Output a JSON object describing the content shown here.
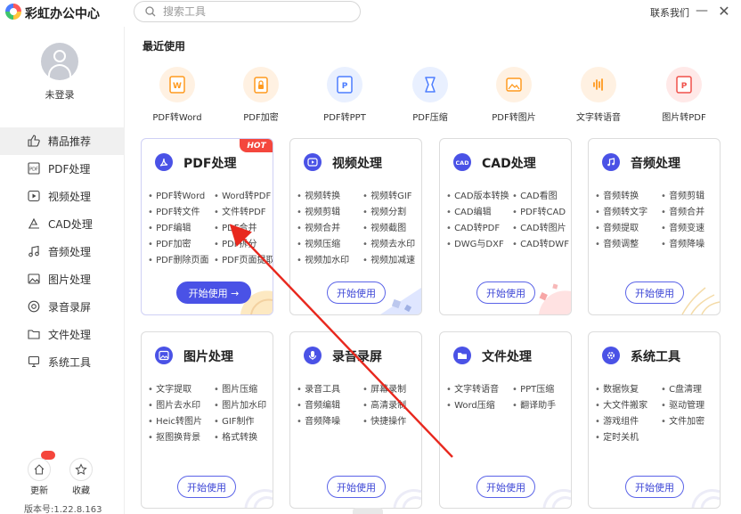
{
  "app": {
    "title": "彩虹办公中心",
    "contact_label": "联系我们",
    "minimize_glyph": "—",
    "close_glyph": "✕"
  },
  "search": {
    "placeholder": "搜索工具",
    "value": ""
  },
  "user": {
    "status": "未登录"
  },
  "sidebar": {
    "items": [
      {
        "label": "精品推荐",
        "icon": "thumbs-up-icon",
        "active": true
      },
      {
        "label": "PDF处理",
        "icon": "pdf-file-icon"
      },
      {
        "label": "视频处理",
        "icon": "video-icon"
      },
      {
        "label": "CAD处理",
        "icon": "cad-icon"
      },
      {
        "label": "音频处理",
        "icon": "music-note-icon"
      },
      {
        "label": "图片处理",
        "icon": "image-icon"
      },
      {
        "label": "录音录屏",
        "icon": "record-icon"
      },
      {
        "label": "文件处理",
        "icon": "folder-icon"
      },
      {
        "label": "系统工具",
        "icon": "monitor-icon"
      }
    ],
    "update_label": "更新",
    "favorite_label": "收藏",
    "version": "版本号:1.22.8.163"
  },
  "recent": {
    "title": "最近使用",
    "items": [
      {
        "label": "PDF转Word",
        "icon": "word-doc-icon",
        "color": "#ff9a1f"
      },
      {
        "label": "PDF加密",
        "icon": "lock-icon",
        "color": "#ff9a1f"
      },
      {
        "label": "PDF转PPT",
        "icon": "ppt-icon",
        "color": "#4c7dff"
      },
      {
        "label": "PDF压缩",
        "icon": "compress-icon",
        "color": "#4c7dff"
      },
      {
        "label": "PDF转图片",
        "icon": "picture-icon",
        "color": "#ff9a1f"
      },
      {
        "label": "文字转语音",
        "icon": "voice-wave-icon",
        "color": "#ff9a1f"
      },
      {
        "label": "图片转PDF",
        "icon": "pdf-icon",
        "color": "#f0504a"
      }
    ]
  },
  "cards": [
    {
      "title": "PDF处理",
      "icon": "pdf-logo-icon",
      "hot": "HOT",
      "features": [
        "PDF转Word",
        "Word转PDF",
        "PDF转文件",
        "文件转PDF",
        "PDF编辑",
        "PDF合并",
        "PDF加密",
        "PDF拆分",
        "PDF删除页面",
        "PDF页面提取"
      ],
      "button": "开始使用 →"
    },
    {
      "title": "视频处理",
      "icon": "play-icon",
      "features": [
        "视频转换",
        "视频转GIF",
        "视频剪辑",
        "视频分割",
        "视频合并",
        "视频截图",
        "视频压缩",
        "视频去水印",
        "视频加水印",
        "视频加减速"
      ],
      "button": "开始使用"
    },
    {
      "title": "CAD处理",
      "icon": "cad-logo-icon",
      "features": [
        "CAD版本转换",
        "CAD看图",
        "CAD编辑",
        "PDF转CAD",
        "CAD转PDF",
        "CAD转图片",
        "DWG与DXF",
        "CAD转DWF"
      ],
      "button": "开始使用"
    },
    {
      "title": "音频处理",
      "icon": "music-logo-icon",
      "features": [
        "音频转换",
        "音频剪辑",
        "音频转文字",
        "音频合并",
        "音频提取",
        "音频变速",
        "音频调整",
        "音频降噪"
      ],
      "button": "开始使用"
    },
    {
      "title": "图片处理",
      "icon": "image-logo-icon",
      "features": [
        "文字提取",
        "图片压缩",
        "图片去水印",
        "图片加水印",
        "Heic转图片",
        "GIF制作",
        "抠图换背景",
        "格式转换"
      ],
      "button": "开始使用"
    },
    {
      "title": "录音录屏",
      "icon": "microphone-icon",
      "features": [
        "录音工具",
        "屏幕录制",
        "音频编辑",
        "高清录制",
        "音频降噪",
        "快捷操作"
      ],
      "button": "开始使用"
    },
    {
      "title": "文件处理",
      "icon": "folder-logo-icon",
      "features": [
        "文字转语音",
        "PPT压缩",
        "Word压缩",
        "翻译助手"
      ],
      "button": "开始使用"
    },
    {
      "title": "系统工具",
      "icon": "gear-logo-icon",
      "features": [
        "数据恢复",
        "C盘清理",
        "大文件搬家",
        "驱动管理",
        "游戏组件",
        "文件加密",
        "定时关机"
      ],
      "button": "开始使用"
    }
  ],
  "colors": {
    "accent": "#4a52e6",
    "hot": "#f4473d",
    "annotation_arrow": "#e8281e"
  }
}
